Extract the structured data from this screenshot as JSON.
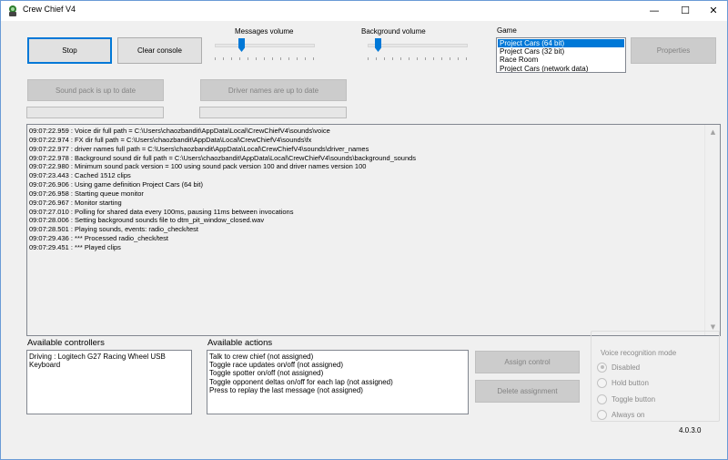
{
  "window": {
    "title": "Crew Chief V4",
    "minimize_glyph": "—",
    "maximize_glyph": "☐",
    "close_glyph": "✕",
    "icon": "crew-chief-app-icon"
  },
  "controls": {
    "stop_label": "Stop",
    "clear_console_label": "Clear console",
    "messages_volume_label": "Messages volume",
    "messages_volume_level": 0.25,
    "background_volume_label": "Background volume",
    "background_volume_level": 0.08,
    "sound_pack_label": "Sound pack is up to date",
    "driver_names_label": "Driver names are up to date",
    "properties_label": "Properties"
  },
  "game": {
    "label": "Game",
    "options": [
      "Project Cars (64 bit)",
      "Project Cars (32 bit)",
      "Race Room",
      "Project Cars (network data)"
    ],
    "selected_index": 0
  },
  "console": {
    "lines": [
      "09:07:22.959 : Voice dir full path = C:\\Users\\chaozbandit\\AppData\\Local\\CrewChiefV4\\sounds\\voice",
      "09:07:22.974 : FX dir full path = C:\\Users\\chaozbandit\\AppData\\Local\\CrewChiefV4\\sounds\\fx",
      "09:07:22.977 : driver names full path = C:\\Users\\chaozbandit\\AppData\\Local\\CrewChiefV4\\sounds\\driver_names",
      "09:07:22.978 : Background sound dir full path = C:\\Users\\chaozbandit\\AppData\\Local\\CrewChiefV4\\sounds\\background_sounds",
      "09:07:22.980 : Minimum sound pack version = 100 using sound pack version 100 and driver names version 100",
      "09:07:23.443 : Cached 1512 clips",
      "09:07:26.906 : Using game definition Project Cars (64 bit)",
      "09:07:26.958 : Starting queue monitor",
      "09:07:26.967 : Monitor starting",
      "09:07:27.010 : Polling for shared data every 100ms, pausing 11ms between invocations",
      "09:07:28.006 : Setting background sounds file to  dtm_pit_window_closed.wav",
      "09:07:28.501 : Playing sounds, events: radio_check/test",
      "09:07:29.436 : *** Processed radio_check/test",
      "09:07:29.451 : *** Played clips"
    ]
  },
  "controllers": {
    "label": "Available controllers",
    "items": [
      "Driving : Logitech G27 Racing Wheel USB",
      "Keyboard"
    ]
  },
  "actions": {
    "label": "Available actions",
    "items": [
      "Talk to crew chief (not assigned)",
      "Toggle race updates on/off (not assigned)",
      "Toggle spotter on/off (not assigned)",
      "Toggle opponent deltas on/off for each lap (not assigned)",
      "Press to replay the last message (not assigned)"
    ],
    "assign_label": "Assign control",
    "delete_label": "Delete assignment"
  },
  "voice": {
    "label": "Voice recognition mode",
    "options": [
      {
        "label": "Disabled",
        "checked": true
      },
      {
        "label": "Hold button",
        "checked": false
      },
      {
        "label": "Toggle button",
        "checked": false
      },
      {
        "label": "Always on",
        "checked": false
      }
    ]
  },
  "version": "4.0.3.0"
}
